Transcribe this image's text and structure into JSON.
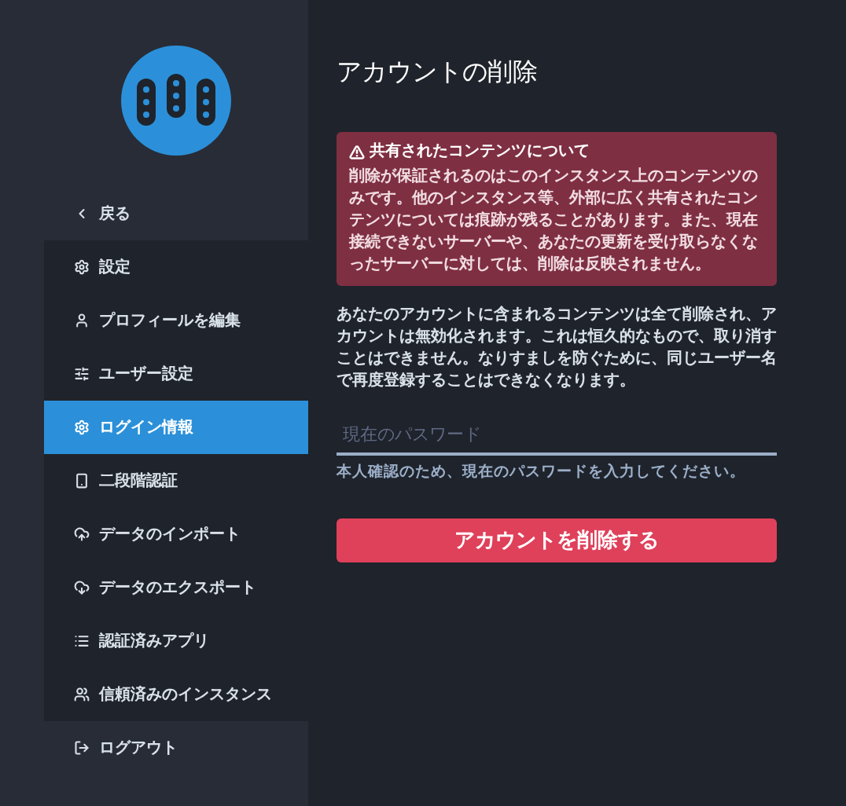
{
  "sidebar": {
    "back": {
      "label": "戻る",
      "selected": false
    },
    "menu": [
      {
        "label": "設定",
        "selected": false
      },
      {
        "label": "プロフィールを編集",
        "selected": false
      },
      {
        "label": "ユーザー設定",
        "selected": false
      },
      {
        "label": "ログイン情報",
        "selected": true
      },
      {
        "label": "二段階認証",
        "selected": false
      },
      {
        "label": "データのインポート",
        "selected": false
      },
      {
        "label": "データのエクスポート",
        "selected": false
      },
      {
        "label": "認証済みアプリ",
        "selected": false
      },
      {
        "label": "信頼済みのインスタンス",
        "selected": false
      }
    ],
    "logout": {
      "label": "ログアウト",
      "selected": false
    }
  },
  "main": {
    "title": "アカウントの削除",
    "alert": {
      "title": "共有されたコンテンツについて",
      "body": "削除が保証されるのはこのインスタンス上のコンテンツのみです。他のインスタンス等、外部に広く共有されたコンテンツについては痕跡が残ることがあります。また、現在接続できないサーバーや、あなたの更新を受け取らなくなったサーバーに対しては、削除は反映されません。"
    },
    "description": "あなたのアカウントに含まれるコンテンツは全て削除され、アカウントは無効化されます。これは恒久的なもので、取り消すことはできません。なりすましを防ぐために、同じユーザー名で再度登録することはできなくなります。",
    "password": {
      "placeholder": "現在のパスワード",
      "hint": "本人確認のため、現在のパスワードを入力してください。"
    },
    "button": "アカウントを削除する"
  }
}
